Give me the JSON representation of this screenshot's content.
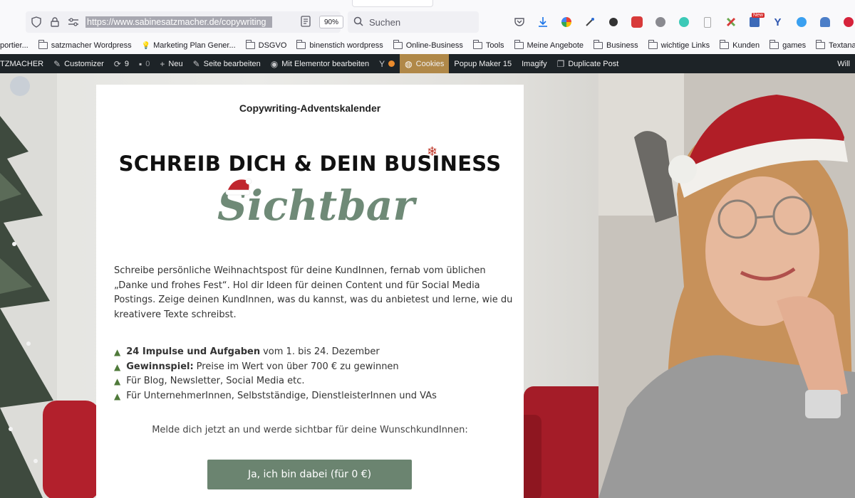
{
  "browser": {
    "url": "https://www.sabinesatzmacher.de/copywriting",
    "zoom": "90%",
    "search_placeholder": "Suchen",
    "extension_icons": [
      "pocket-icon",
      "download-icon",
      "google-icon",
      "eyedropper-icon",
      "extension-icon",
      "adblock-icon",
      "settings-icon",
      "m-icon",
      "phone-icon",
      "puzzle-icon",
      "news-icon",
      "y-icon",
      "refresh-icon",
      "ghost-icon",
      "pinterest-icon"
    ],
    "news_badge": "New"
  },
  "bookmarks": [
    {
      "label": "portier...",
      "type": "link"
    },
    {
      "label": "satzmacher Wordpress",
      "type": "folder"
    },
    {
      "label": "Marketing Plan Gener...",
      "type": "link"
    },
    {
      "label": "DSGVO",
      "type": "folder"
    },
    {
      "label": "binenstich wordpress",
      "type": "folder"
    },
    {
      "label": "Online-Business",
      "type": "folder"
    },
    {
      "label": "Tools",
      "type": "folder"
    },
    {
      "label": "Meine Angebote",
      "type": "folder"
    },
    {
      "label": "Business",
      "type": "folder"
    },
    {
      "label": "wichtige Links",
      "type": "folder"
    },
    {
      "label": "Kunden",
      "type": "folder"
    },
    {
      "label": "games",
      "type": "folder"
    },
    {
      "label": "Textanalyse",
      "type": "folder"
    }
  ],
  "adminbar": {
    "site": "TZMACHER",
    "customizer": "Customizer",
    "updates": "9",
    "comments": "0",
    "new": "Neu",
    "edit": "Seite bearbeiten",
    "elementor": "Mit Elementor bearbeiten",
    "cookies": "Cookies",
    "popup": "Popup Maker 15",
    "imagify": "Imagify",
    "duplicate": "Duplicate Post",
    "user": "Will"
  },
  "card": {
    "kicker": "Copywriting-Adventskalender",
    "headline": "SCHREIB DICH & DEIN BUSINESS",
    "script": "Sichtbar",
    "body": "Schreibe persönliche Weihnachtspost für deine KundInnen, fernab vom üblichen „Danke und frohes Fest“. Hol dir Ideen für deinen Content und für Social Media Postings. Zeige deinen KundInnen, was du kannst, was du anbietest und lerne, wie du kreativere Texte schreibst.",
    "bullets": [
      {
        "bold": "24 Impulse und Aufgaben",
        "text": "vom 1. bis 24. Dezember"
      },
      {
        "bold": "Gewinnspiel:",
        "text": "Preise im Wert von über 700 € zu gewinnen"
      },
      {
        "bold": "",
        "text": "Für Blog, Newsletter, Social Media etc."
      },
      {
        "bold": "",
        "text": "Für UnternehmerInnen, Selbstständige, DienstleisterInnen und VAs"
      }
    ],
    "cta_line": "Melde dich jetzt an und werde sichtbar für deine WunschkundInnen:",
    "cta_button": "Ja, ich bin dabei (für 0 €)"
  },
  "colors": {
    "adminbar": "#1d2327",
    "cookies": "#b08848",
    "button": "#6b8470",
    "script": "#6f8a77"
  }
}
